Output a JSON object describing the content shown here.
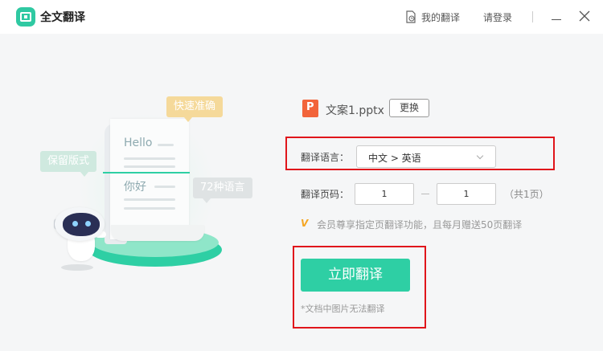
{
  "app": {
    "title": "全文翻译"
  },
  "header": {
    "my_translations": "我的翻译",
    "login": "请登录"
  },
  "illustration": {
    "bubble_fast": "快速准确",
    "bubble_format": "保留版式",
    "bubble_languages": "72种语言",
    "sample_en": "Hello",
    "sample_zh": "你好"
  },
  "file": {
    "name": "文案1.pptx",
    "icon_letter": "P",
    "change_label": "更换",
    "icon": "powerpoint-file-icon"
  },
  "language": {
    "label": "翻译语言：",
    "value": "中文 > 英语"
  },
  "pages": {
    "label": "翻译页码：",
    "from": "1",
    "to": "1",
    "total": "（共1页）"
  },
  "vip": {
    "icon_text": "V",
    "note": "会员尊享指定页翻译功能，且每月赠送50页翻译"
  },
  "action": {
    "translate_label": "立即翻译",
    "note": "*文档中图片无法翻译"
  },
  "colors": {
    "accent": "#2ecfa4",
    "highlight": "#e0151b",
    "file_icon": "#f2643a"
  }
}
